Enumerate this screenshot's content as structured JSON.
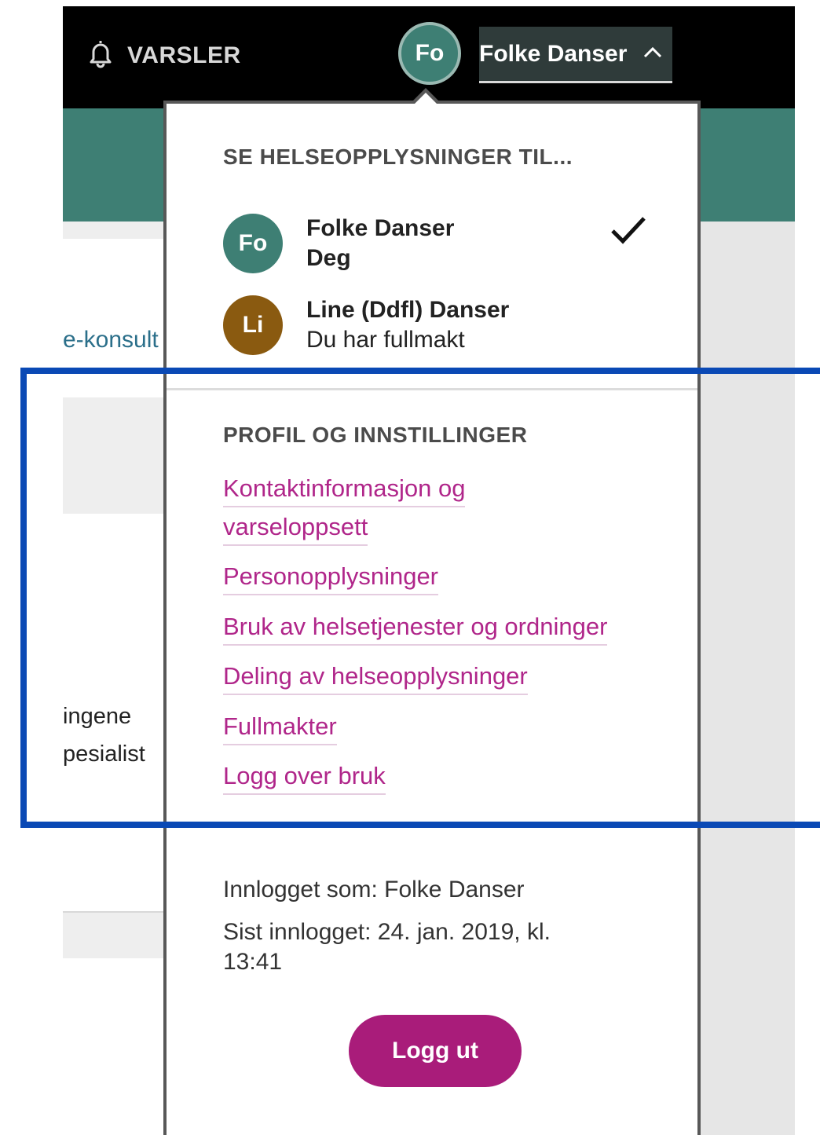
{
  "header": {
    "notifications_label": "VARSLER",
    "user_initials": "Fo",
    "user_name": "Folke Danser"
  },
  "background": {
    "link_fragment": "e-konsult",
    "text_line1": "ingene",
    "text_line2": "pesialist"
  },
  "dropdown": {
    "section1_heading": "SE HELSEOPPLYSNINGER TIL...",
    "persons": [
      {
        "initials": "Fo",
        "name": "Folke Danser",
        "subtitle": "Deg",
        "selected": true,
        "color": "#3e7f74"
      },
      {
        "initials": "Li",
        "name": "Line (Ddfl) Danser",
        "subtitle": "Du har fullmakt",
        "selected": false,
        "color": "#8a5a10"
      }
    ],
    "section2_heading": "PROFIL OG INNSTILLINGER",
    "links": {
      "contact_line1": "Kontaktinformasjon og",
      "contact_line2": "varseloppsett",
      "personal": "Personopplysninger",
      "usage": "Bruk av helsetjenester og ordninger",
      "sharing": "Deling av helseopplysninger",
      "proxies": "Fullmakter",
      "log": "Logg over bruk"
    },
    "logged_in_as": "Innlogget som: Folke Danser",
    "last_login_line1": "Sist innlogget: 24. jan. 2019, kl.",
    "last_login_line2": "13:41",
    "logout_label": "Logg ut"
  },
  "colors": {
    "accent": "#a91c7a",
    "link": "#b0268a",
    "teal": "#3e7f74",
    "highlight": "#0a49b5"
  }
}
